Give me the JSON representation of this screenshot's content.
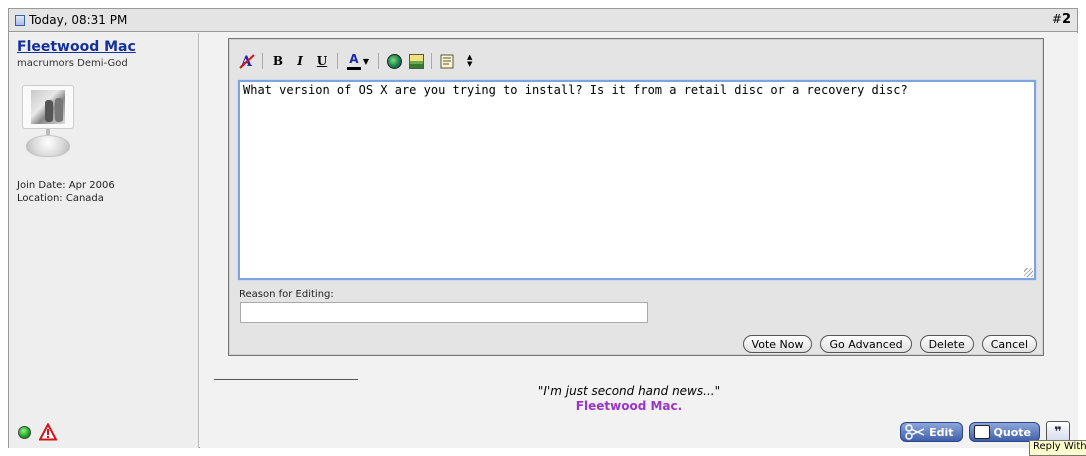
{
  "header": {
    "date": "Today, 08:31 PM",
    "post_prefix": "#",
    "post_number": "2"
  },
  "user": {
    "name": "Fleetwood Mac",
    "title": "macrumors Demi-God",
    "join_date": "Join Date: Apr 2006",
    "location": "Location: Canada"
  },
  "toolbar": {
    "bold": "B",
    "italic": "I",
    "underline": "U",
    "font_color": "A",
    "items": [
      "remove-format",
      "bold",
      "italic",
      "underline",
      "font-color",
      "insert-link",
      "insert-image",
      "wrap-quote",
      "resize"
    ]
  },
  "editor": {
    "message": "What version of OS X are you trying to install? Is it from a retail disc or a recovery disc?",
    "reason_label": "Reason for Editing:",
    "reason_value": ""
  },
  "buttons": {
    "vote_now": "Vote Now",
    "go_advanced": "Go Advanced",
    "delete": "Delete",
    "cancel": "Cancel"
  },
  "signature": {
    "quote": "\"I'm just second hand news...\"",
    "name": "Fleetwood Mac."
  },
  "post_buttons": {
    "edit": "Edit",
    "quote": "Quote"
  },
  "tooltip": "Reply With",
  "colors": {
    "username": "#13309b",
    "signature_name": "#9b35c4",
    "textarea_border": "#7ea4e0"
  }
}
